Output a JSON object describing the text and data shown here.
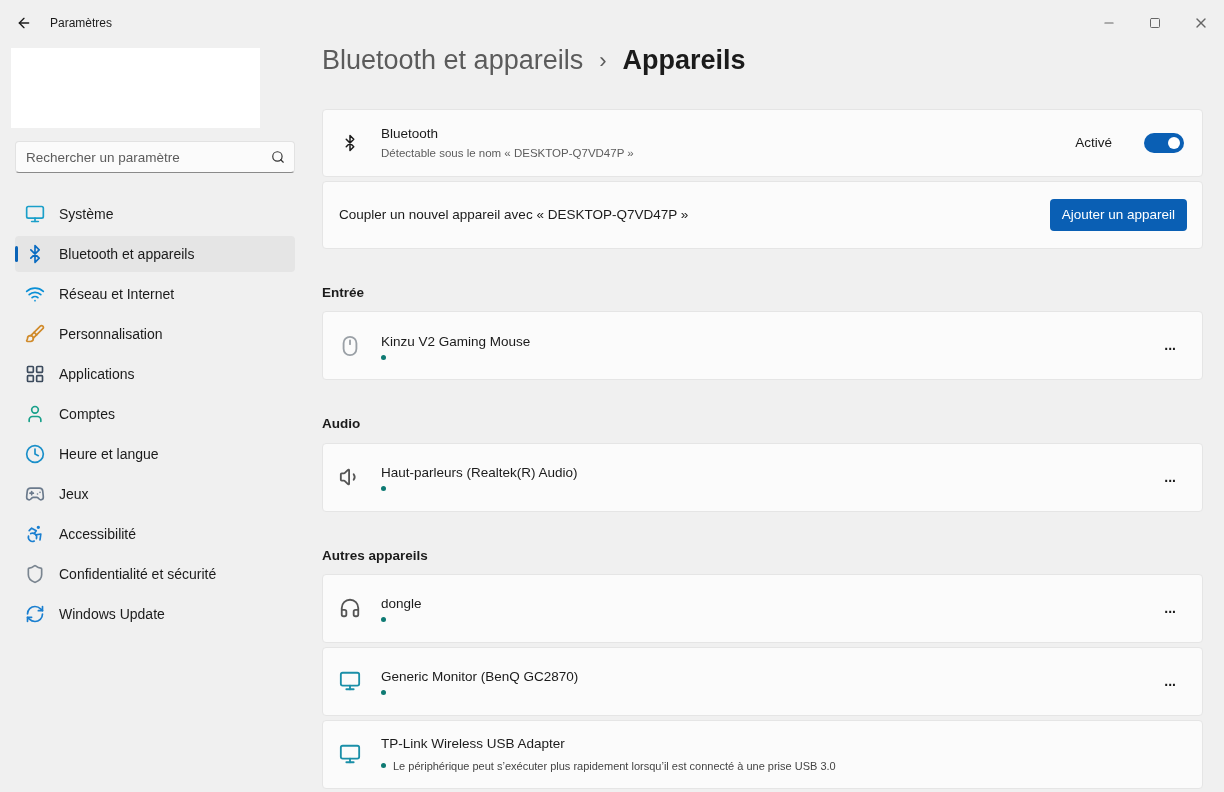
{
  "window": {
    "title": "Paramètres"
  },
  "search": {
    "placeholder": "Rechercher un paramètre"
  },
  "sidebar": {
    "items": [
      {
        "label": "Système",
        "selected": false
      },
      {
        "label": "Bluetooth et appareils",
        "selected": true
      },
      {
        "label": "Réseau et Internet",
        "selected": false
      },
      {
        "label": "Personnalisation",
        "selected": false
      },
      {
        "label": "Applications",
        "selected": false
      },
      {
        "label": "Comptes",
        "selected": false
      },
      {
        "label": "Heure et langue",
        "selected": false
      },
      {
        "label": "Jeux",
        "selected": false
      },
      {
        "label": "Accessibilité",
        "selected": false
      },
      {
        "label": "Confidentialité et sécurité",
        "selected": false
      },
      {
        "label": "Windows Update",
        "selected": false
      }
    ]
  },
  "breadcrumb": {
    "parent": "Bluetooth et appareils",
    "separator": "›",
    "current": "Appareils"
  },
  "bluetooth": {
    "title": "Bluetooth",
    "subtitle": "Détectable sous le nom « DESKTOP-Q7VD47P »",
    "state_label": "Activé",
    "on": true
  },
  "pairing": {
    "text": "Coupler un nouvel appareil avec « DESKTOP-Q7VD47P »",
    "button": "Ajouter un appareil"
  },
  "sections": [
    {
      "title": "Entrée",
      "devices": [
        {
          "name": "Kinzu V2 Gaming Mouse",
          "menu": "..."
        }
      ]
    },
    {
      "title": "Audio",
      "devices": [
        {
          "name": "Haut-parleurs (Realtek(R) Audio)",
          "menu": "..."
        }
      ]
    },
    {
      "title": "Autres appareils",
      "devices": [
        {
          "name": "dongle",
          "menu": "..."
        },
        {
          "name": "Generic Monitor (BenQ GC2870)",
          "menu": "..."
        },
        {
          "name": "TP-Link Wireless USB Adapter",
          "status": "Le périphérique peut s’exécuter plus rapidement lorsqu’il est connecté à une prise USB 3.0"
        }
      ]
    }
  ]
}
